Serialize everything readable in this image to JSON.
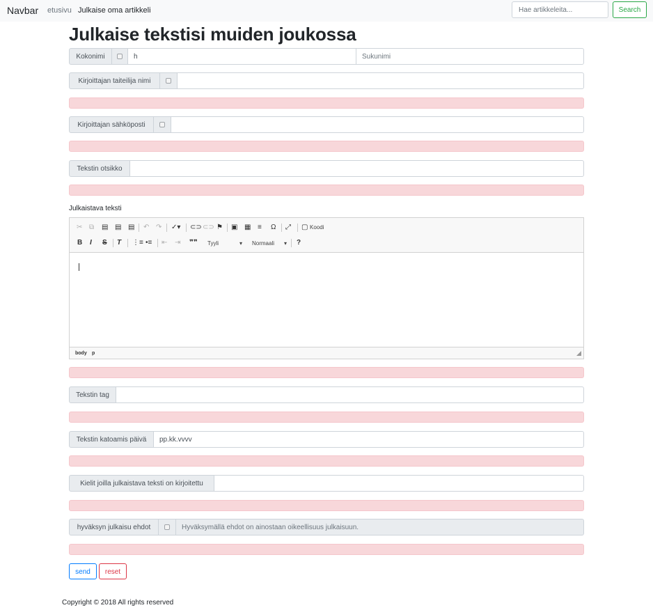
{
  "navbar": {
    "brand": "Navbar",
    "links": [
      {
        "label": "etusivu"
      },
      {
        "label": "Julkaise oma artikkeli"
      }
    ],
    "search_placeholder": "Hae artikkeleita...",
    "search_button": "Search"
  },
  "page_title": "Julkaise tekstisi muiden joukossa",
  "form": {
    "full_name": {
      "label": "Kokonimi",
      "first_value": "h",
      "last_placeholder": "Sukunimi"
    },
    "artist_name": {
      "label": "Kirjoittajan taiteilija nimi",
      "value": ""
    },
    "email": {
      "label": "Kirjoittajan sähköposti",
      "value": ""
    },
    "text_title": {
      "label": "Tekstin otsikko",
      "value": ""
    },
    "text_label": "Julkaistava teksti",
    "editor": {
      "source_label": "Koodi",
      "style_combo": "Tyyli",
      "format_combo": "Normaali",
      "path": [
        "body",
        "p"
      ]
    },
    "tag": {
      "label": "Tekstin tag",
      "value": ""
    },
    "expiry_date": {
      "label": "Tekstin katoamis päivä",
      "placeholder": "pp.kk.vvvv"
    },
    "languages": {
      "label": "Kielit joilla julkaistava teksti on kirjoitettu",
      "value": ""
    },
    "terms": {
      "label": "hyväksyn julkaisu ehdot",
      "text": "Hyväksymällä ehdot on ainostaan oikeellisuus julkaisuun."
    },
    "send_button": "send",
    "reset_button": "reset"
  },
  "footer": "Copyright © 2018 All rights reserved",
  "colors": {
    "error_bg": "#f8d7da",
    "success": "#28a745",
    "primary": "#007bff",
    "danger": "#dc3545"
  }
}
